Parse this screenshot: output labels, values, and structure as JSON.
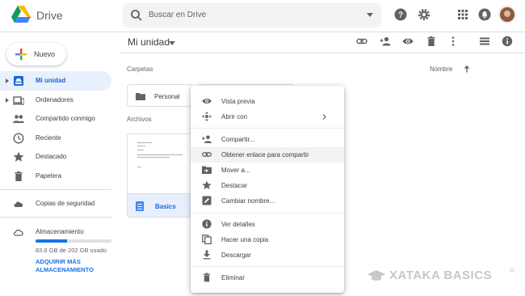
{
  "app": {
    "name": "Drive"
  },
  "search": {
    "placeholder": "Buscar en Drive"
  },
  "header_icons": [
    "help-icon",
    "settings-icon",
    "apps-grid-icon",
    "notifications-icon"
  ],
  "new_button": {
    "label": "Nuevo"
  },
  "sidebar": {
    "items": [
      {
        "label": "Mi unidad",
        "icon": "my-drive-icon",
        "active": true,
        "expandable": true
      },
      {
        "label": "Ordenadores",
        "icon": "computers-icon",
        "active": false,
        "expandable": true
      },
      {
        "label": "Compartido conmigo",
        "icon": "shared-people-icon",
        "active": false
      },
      {
        "label": "Reciente",
        "icon": "clock-icon",
        "active": false
      },
      {
        "label": "Destacado",
        "icon": "star-icon",
        "active": false
      },
      {
        "label": "Papelera",
        "icon": "trash-icon",
        "active": false
      },
      {
        "label": "Copias de seguridad",
        "icon": "cloud-backup-icon",
        "active": false
      }
    ],
    "storage": {
      "label": "Almacenamiento",
      "usage_text": "83,6 GB de 202 GB usado",
      "used_fraction": 0.414,
      "upgrade_link": "ADQUIRIR MÁS ALMACENAMIENTO"
    }
  },
  "toolbar": {
    "title": "Mi unidad",
    "icons": [
      "link-icon",
      "add-person-icon",
      "preview-eye-icon",
      "delete-icon",
      "more-vert-icon",
      "list-view-icon",
      "info-icon"
    ]
  },
  "main": {
    "folders_label": "Carpetas",
    "sort_label": "Nombre",
    "folders": [
      {
        "name": "Personal"
      }
    ],
    "files_label": "Archivos",
    "files": [
      {
        "name": "Basics"
      }
    ]
  },
  "context_menu": {
    "items": [
      {
        "label": "Vista previa",
        "icon": "eye-icon"
      },
      {
        "label": "Abrir con",
        "icon": "open-with-icon",
        "submenu": true
      },
      {
        "label": "Compartir...",
        "icon": "add-person-icon"
      },
      {
        "label": "Obtener enlace para compartir",
        "icon": "link-icon",
        "hover": true
      },
      {
        "label": "Mover a...",
        "icon": "move-folder-icon"
      },
      {
        "label": "Destacar",
        "icon": "star-icon"
      },
      {
        "label": "Cambiar nombre...",
        "icon": "rename-icon"
      },
      {
        "label": "Ver detalles",
        "icon": "info-icon"
      },
      {
        "label": "Hacer una copia",
        "icon": "copy-icon"
      },
      {
        "label": "Descargar",
        "icon": "download-icon"
      },
      {
        "label": "Eliminar",
        "icon": "trash-icon"
      }
    ]
  },
  "watermark": {
    "text": "XATAKA BASICS",
    "mark": "®"
  },
  "colors": {
    "accent": "#1a73e8",
    "active_bg": "#e8f0fe",
    "text": "#3c4043",
    "muted": "#5f6368"
  }
}
